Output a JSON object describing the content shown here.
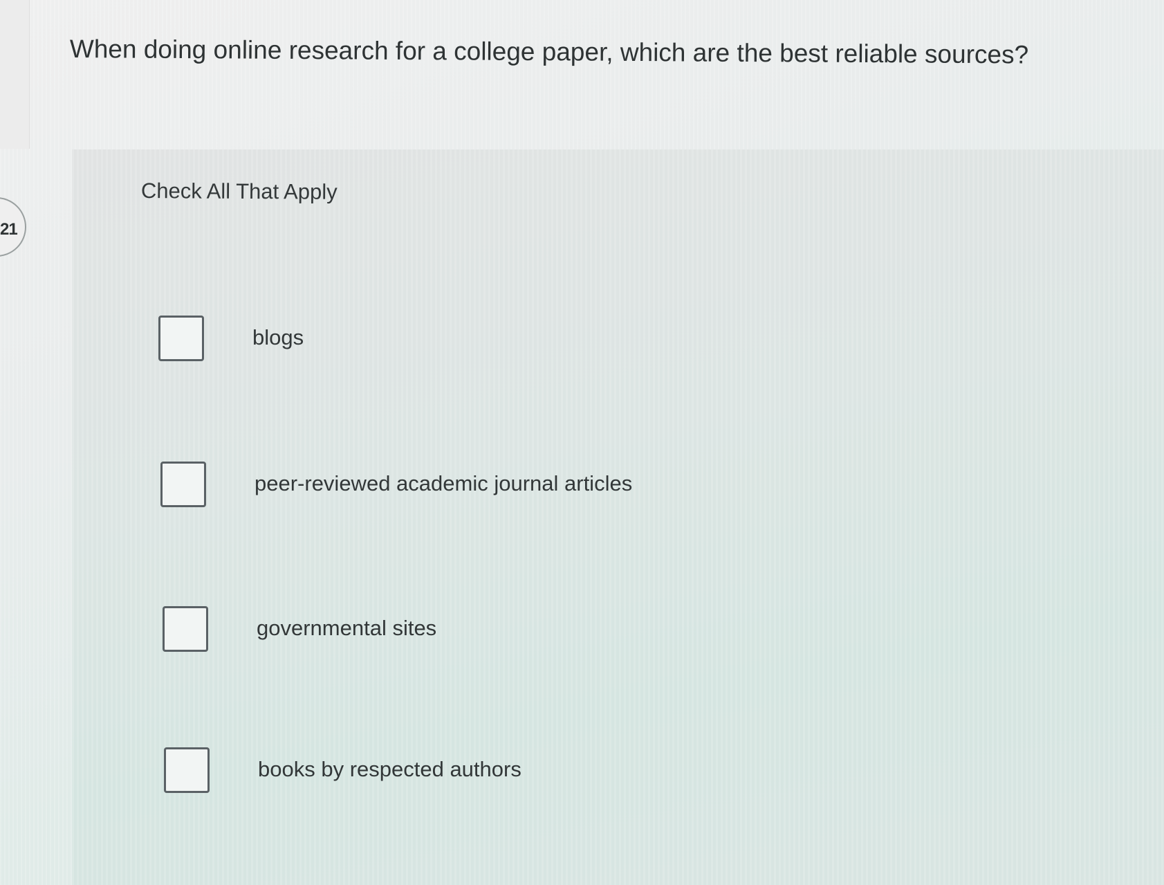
{
  "question": {
    "number": "21",
    "text": "When doing online research for a college paper, which are the best reliable sources?"
  },
  "instruction": "Check All That Apply",
  "options": [
    {
      "label": "blogs",
      "checked": false
    },
    {
      "label": "peer-reviewed academic journal articles",
      "checked": false
    },
    {
      "label": "governmental sites",
      "checked": false
    },
    {
      "label": "books by respected authors",
      "checked": false
    }
  ]
}
